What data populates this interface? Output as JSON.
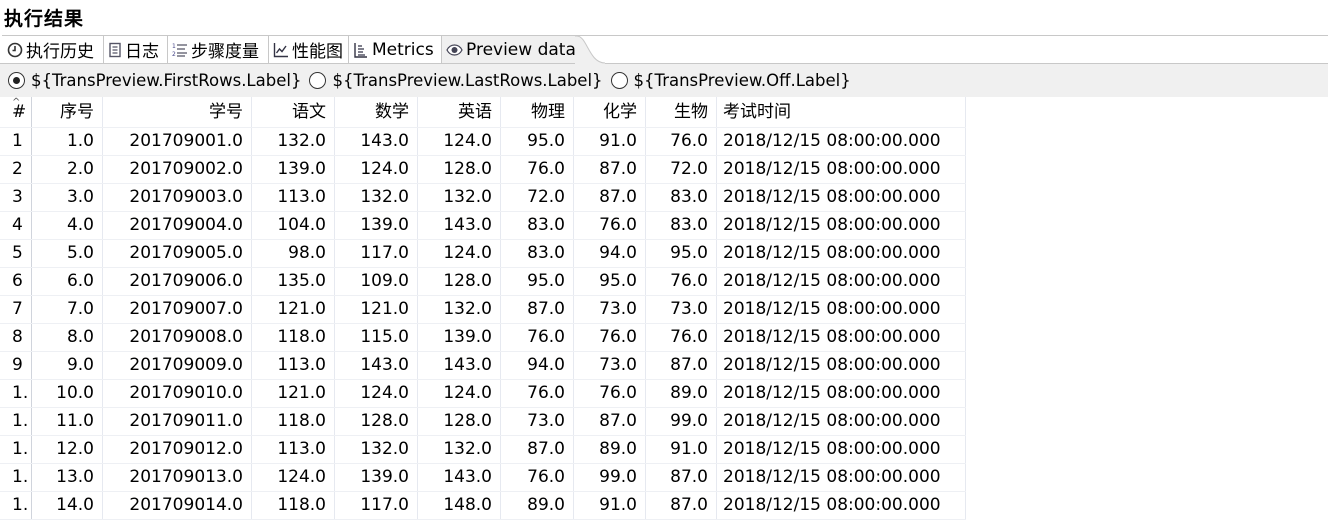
{
  "title": "执行结果",
  "tabs": [
    {
      "label": "执行历史",
      "icon": "clock-icon"
    },
    {
      "label": "日志",
      "icon": "log-icon"
    },
    {
      "label": "步骤度量",
      "icon": "list-numbered-icon"
    },
    {
      "label": "性能图",
      "icon": "chart-icon"
    },
    {
      "label": "Metrics",
      "icon": "metrics-icon"
    },
    {
      "label": "Preview data",
      "icon": "eye-icon",
      "selected": true
    }
  ],
  "radios": [
    {
      "label": "${TransPreview.FirstRows.Label}",
      "checked": true
    },
    {
      "label": "${TransPreview.LastRows.Label}",
      "checked": false
    },
    {
      "label": "${TransPreview.Off.Label}",
      "checked": false
    }
  ],
  "table": {
    "columns": [
      "#",
      "序号",
      "学号",
      "语文",
      "数学",
      "英语",
      "物理",
      "化学",
      "生物",
      "考试时间"
    ],
    "rows": [
      [
        "1",
        "1.0",
        "201709001.0",
        "132.0",
        "143.0",
        "124.0",
        "95.0",
        "91.0",
        "76.0",
        "2018/12/15 08:00:00.000"
      ],
      [
        "2",
        "2.0",
        "201709002.0",
        "139.0",
        "124.0",
        "128.0",
        "76.0",
        "87.0",
        "72.0",
        "2018/12/15 08:00:00.000"
      ],
      [
        "3",
        "3.0",
        "201709003.0",
        "113.0",
        "132.0",
        "132.0",
        "72.0",
        "87.0",
        "83.0",
        "2018/12/15 08:00:00.000"
      ],
      [
        "4",
        "4.0",
        "201709004.0",
        "104.0",
        "139.0",
        "143.0",
        "83.0",
        "76.0",
        "83.0",
        "2018/12/15 08:00:00.000"
      ],
      [
        "5",
        "5.0",
        "201709005.0",
        "98.0",
        "117.0",
        "124.0",
        "83.0",
        "94.0",
        "95.0",
        "2018/12/15 08:00:00.000"
      ],
      [
        "6",
        "6.0",
        "201709006.0",
        "135.0",
        "109.0",
        "128.0",
        "95.0",
        "95.0",
        "76.0",
        "2018/12/15 08:00:00.000"
      ],
      [
        "7",
        "7.0",
        "201709007.0",
        "121.0",
        "121.0",
        "132.0",
        "87.0",
        "73.0",
        "73.0",
        "2018/12/15 08:00:00.000"
      ],
      [
        "8",
        "8.0",
        "201709008.0",
        "118.0",
        "115.0",
        "139.0",
        "76.0",
        "76.0",
        "76.0",
        "2018/12/15 08:00:00.000"
      ],
      [
        "9",
        "9.0",
        "201709009.0",
        "113.0",
        "143.0",
        "143.0",
        "94.0",
        "73.0",
        "87.0",
        "2018/12/15 08:00:00.000"
      ],
      [
        "1.",
        "10.0",
        "201709010.0",
        "121.0",
        "124.0",
        "124.0",
        "76.0",
        "76.0",
        "89.0",
        "2018/12/15 08:00:00.000"
      ],
      [
        "1.",
        "11.0",
        "201709011.0",
        "118.0",
        "128.0",
        "128.0",
        "73.0",
        "87.0",
        "99.0",
        "2018/12/15 08:00:00.000"
      ],
      [
        "1.",
        "12.0",
        "201709012.0",
        "113.0",
        "132.0",
        "132.0",
        "87.0",
        "89.0",
        "91.0",
        "2018/12/15 08:00:00.000"
      ],
      [
        "1.",
        "13.0",
        "201709013.0",
        "124.0",
        "139.0",
        "143.0",
        "76.0",
        "99.0",
        "87.0",
        "2018/12/15 08:00:00.000"
      ],
      [
        "1.",
        "14.0",
        "201709014.0",
        "118.0",
        "117.0",
        "148.0",
        "89.0",
        "91.0",
        "87.0",
        "2018/12/15 08:00:00.000"
      ]
    ]
  }
}
